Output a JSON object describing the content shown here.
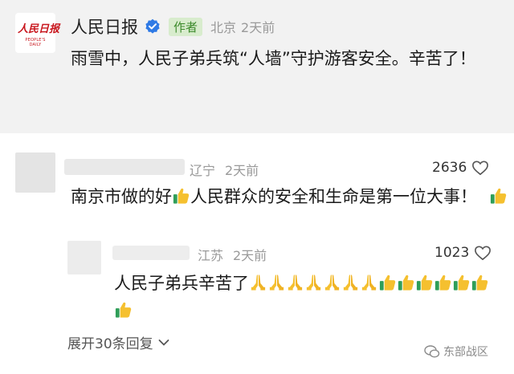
{
  "post": {
    "logo_text": "人民日报",
    "logo_subtext": "PEOPLE'S DAILY",
    "author": "人民日报",
    "author_badge": "作者",
    "location": "北京",
    "time": "2天前",
    "text": "雨雪中，人民子弟兵筑“人墙”守护游客安全。辛苦了！"
  },
  "comment1": {
    "location": "辽宁",
    "time": "2天前",
    "likes": "2636",
    "text_part1": "南京市做的好",
    "text_part2": "人民群众的安全和生命是第一位大事！",
    "emoji": "thumbs-up-icon"
  },
  "comment2": {
    "location": "江苏",
    "time": "2天前",
    "likes": "1023",
    "text": "人民子弟兵辛苦了",
    "emojis": [
      "folded-hands-icon",
      "thumbs-up-icon"
    ]
  },
  "expand_replies": "展开30条回复",
  "watermark": "东部战区",
  "colors": {
    "logo_red": "#c8161d",
    "badge_bg": "#d8eccd",
    "badge_text": "#3c8a2b",
    "verified_blue": "#2f7ae5"
  }
}
